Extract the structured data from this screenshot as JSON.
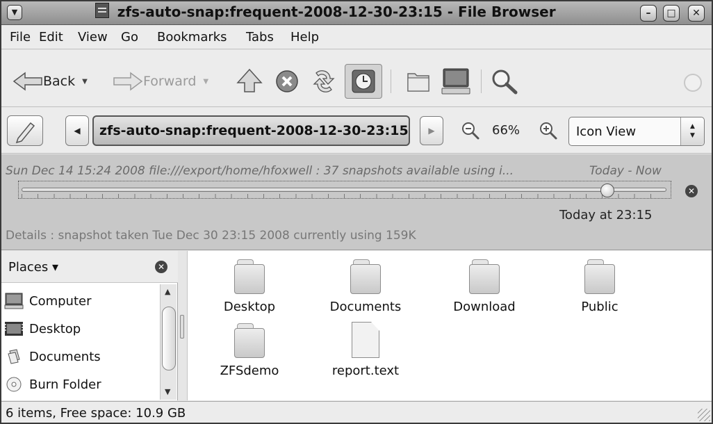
{
  "window": {
    "title": "zfs-auto-snap:frequent-2008-12-30-23:15 - File Browser",
    "menu_icon": "▼",
    "minimize_icon": "–",
    "maximize_icon": "□",
    "close_icon": "✕"
  },
  "menubar": {
    "items": [
      "File",
      "Edit",
      "View",
      "Go",
      "Bookmarks",
      "Tabs",
      "Help"
    ]
  },
  "toolbar": {
    "back_label": "Back",
    "forward_label": "Forward",
    "dropdown_arrow": "▼"
  },
  "location": {
    "path_button": "zfs-auto-snap:frequent-2008-12-30-23:15",
    "zoom_level": "66%",
    "view_mode": "Icon View",
    "left_arrow": "◀",
    "right_arrow": "▶"
  },
  "timeslider": {
    "info": "Sun Dec 14 15:24 2008  file:///export/home/hfoxwell : 37 snapshots available using i...",
    "range": "Today - Now",
    "position_fraction": 0.91,
    "current_label": "Today at 23:15",
    "details": "Details : snapshot taken Tue Dec 30 23:15 2008 currently using 159K",
    "close_icon": "✕"
  },
  "sidebar": {
    "header": "Places ▾",
    "close_icon": "✕",
    "places": [
      {
        "label": "Computer",
        "icon": "computer-icon"
      },
      {
        "label": "Desktop",
        "icon": "desktop-icon"
      },
      {
        "label": "Documents",
        "icon": "documents-icon"
      },
      {
        "label": "Burn Folder",
        "icon": "burn-folder-icon"
      }
    ],
    "scroll_up": "▲",
    "scroll_down": "▼"
  },
  "files": [
    {
      "name": "Desktop",
      "type": "folder"
    },
    {
      "name": "Documents",
      "type": "folder"
    },
    {
      "name": "Download",
      "type": "folder"
    },
    {
      "name": "Public",
      "type": "folder"
    },
    {
      "name": "ZFSdemo",
      "type": "folder"
    },
    {
      "name": "report.text",
      "type": "file"
    }
  ],
  "statusbar": {
    "text": "6 items, Free space: 10.9 GB"
  }
}
